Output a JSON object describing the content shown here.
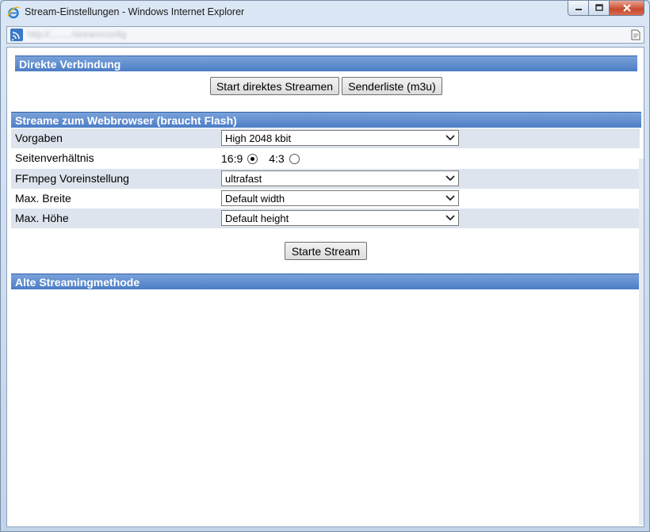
{
  "window": {
    "title": "Stream-Einstellungen - Windows Internet Explorer",
    "address": "http://........./stream/config"
  },
  "sections": {
    "direct": "Direkte Verbindung",
    "webbrowser": "Streame zum Webbrowser (braucht Flash)",
    "legacy": "Alte Streamingmethode"
  },
  "buttons": {
    "direct_stream": "Start direktes Streamen",
    "station_list": "Senderliste (m3u)",
    "start_stream": "Starte Stream"
  },
  "form": {
    "presets": {
      "label": "Vorgaben",
      "value": "High 2048 kbit"
    },
    "aspect": {
      "label": "Seitenverhältnis",
      "options": [
        {
          "label": "16:9",
          "checked": true
        },
        {
          "label": "4:3",
          "checked": false
        }
      ]
    },
    "ffmpeg": {
      "label": "FFmpeg Voreinstellung",
      "value": "ultrafast"
    },
    "max_width": {
      "label": "Max. Breite",
      "value": "Default width"
    },
    "max_height": {
      "label": "Max. Höhe",
      "value": "Default height"
    }
  },
  "icons": {
    "app": "ie-icon",
    "address": "feed-icon",
    "compat": "page-icon"
  }
}
